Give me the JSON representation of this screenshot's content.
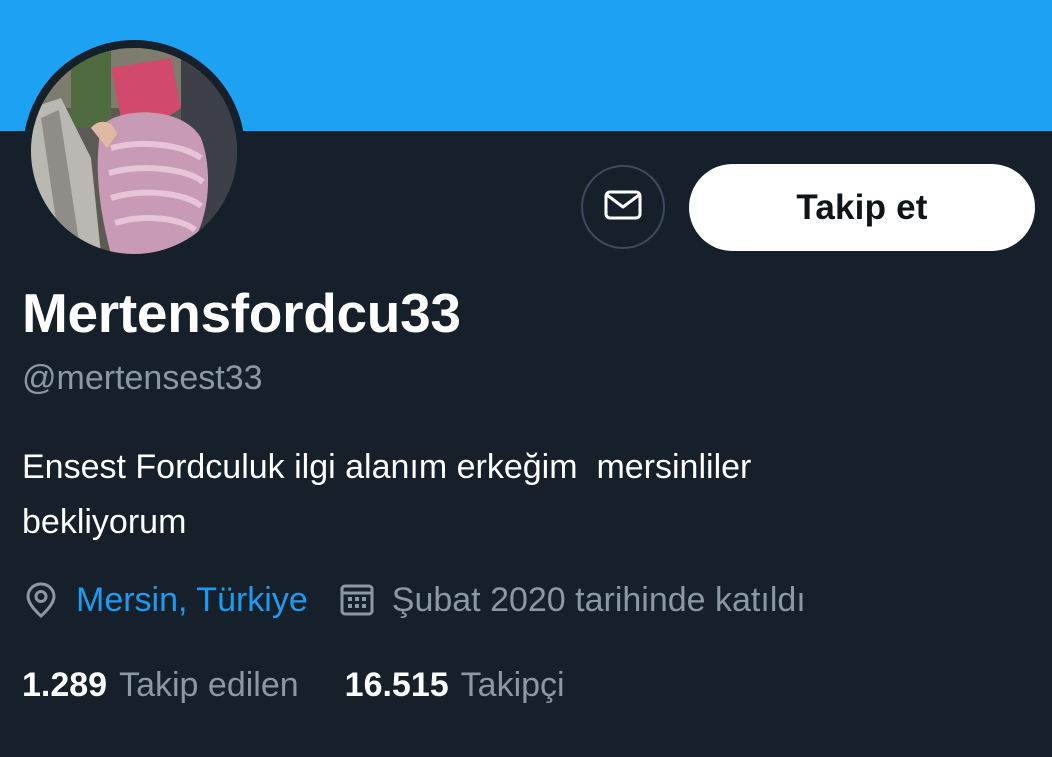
{
  "profile": {
    "display_name": "Mertensfordcu33",
    "handle": "@mertensest33",
    "bio": "Ensest Fordculuk ilgi alanım erkeğim  mersinliler\nbekliyorum",
    "location": "Mersin, Türkiye",
    "joined": "Şubat 2020 tarihinde katıldı"
  },
  "actions": {
    "follow_label": "Takip et",
    "message_icon": "envelope-icon"
  },
  "stats": {
    "following_count": "1.289",
    "following_label": "Takip edilen",
    "followers_count": "16.515",
    "followers_label": "Takipçi"
  },
  "colors": {
    "banner": "#1da1f2",
    "background": "#15202b",
    "accent_link": "#1d9bf0",
    "secondary_text": "#8b98a5",
    "primary_text": "#ffffff"
  },
  "icons": {
    "location": "location-pin-icon",
    "calendar": "calendar-icon"
  }
}
